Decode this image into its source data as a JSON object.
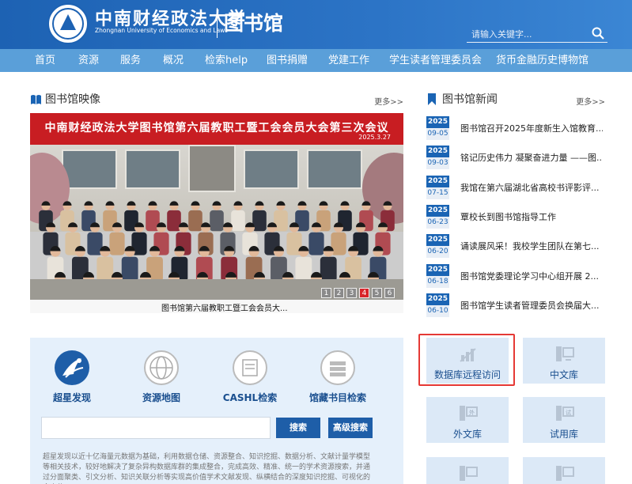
{
  "header": {
    "school_cn": "中南财经政法大学",
    "school_en": "Zhongnan University of Economics and Law",
    "library": "图书馆",
    "search_placeholder": "请输入关键字..."
  },
  "nav": {
    "items": [
      "首页",
      "资源",
      "服务",
      "概况",
      "检索help",
      "图书捐赠",
      "党建工作",
      "学生读者管理委员会",
      "货币金融历史博物馆"
    ]
  },
  "gallery": {
    "title": "图书馆映像",
    "more": "更多>>",
    "banner": "中南财经政法大学图书馆第六届教职工暨工会会员大会第三次会议",
    "banner_date": "2025.3.27",
    "caption": "图书馆第六届教职工暨工会会员大...",
    "pages": [
      "1",
      "2",
      "3",
      "4",
      "5",
      "6"
    ],
    "active_page": "4"
  },
  "news": {
    "title": "图书馆新闻",
    "more": "更多>>",
    "items": [
      {
        "year": "2025",
        "md": "09-05",
        "title": "图书馆召开2025年度新生入馆教育..."
      },
      {
        "year": "2025",
        "md": "09-03",
        "title": "铭记历史伟力 凝聚奋进力量 ——图..."
      },
      {
        "year": "2025",
        "md": "07-15",
        "title": "我馆在第六届湖北省高校书评影评..."
      },
      {
        "year": "2025",
        "md": "06-23",
        "title": "覃校长到图书馆指导工作"
      },
      {
        "year": "2025",
        "md": "06-20",
        "title": "诵读展风采！我校学生团队在第七..."
      },
      {
        "year": "2025",
        "md": "06-18",
        "title": "图书馆党委理论学习中心组开展 2..."
      },
      {
        "year": "2025",
        "md": "06-10",
        "title": "图书馆学生读者管理委员会换届大..."
      }
    ]
  },
  "search_panel": {
    "tools": [
      "超星发现",
      "资源地图",
      "CASHL检索",
      "馆藏书目检索"
    ],
    "search_button": "搜索",
    "advanced_button": "高级搜索",
    "description": "超星发现以近十亿海量元数据为基础，利用数据仓储、资源整合、知识挖掘、数据分析、文献计量学模型等相关技术，较好地解决了复杂异构数据库群的集成整合，完成高效、精准、统一的学术资源搜索，并通过分面聚类、引文分析、知识关联分析等实现高价值学术文献发现、纵横结合的深度知识挖掘、可视化的全方位"
  },
  "tiles": {
    "items": [
      "数据库远程访问",
      "中文库",
      "外文库",
      "试用库"
    ],
    "icon_chars": [
      "",
      "",
      "外",
      "试"
    ]
  },
  "colors": {
    "header_blue": "#1d62b3",
    "nav_blue": "#5a9fd9",
    "banner_red": "#c81d22",
    "highlight_red": "#e53935",
    "panel_bg": "#e5f0fb"
  }
}
